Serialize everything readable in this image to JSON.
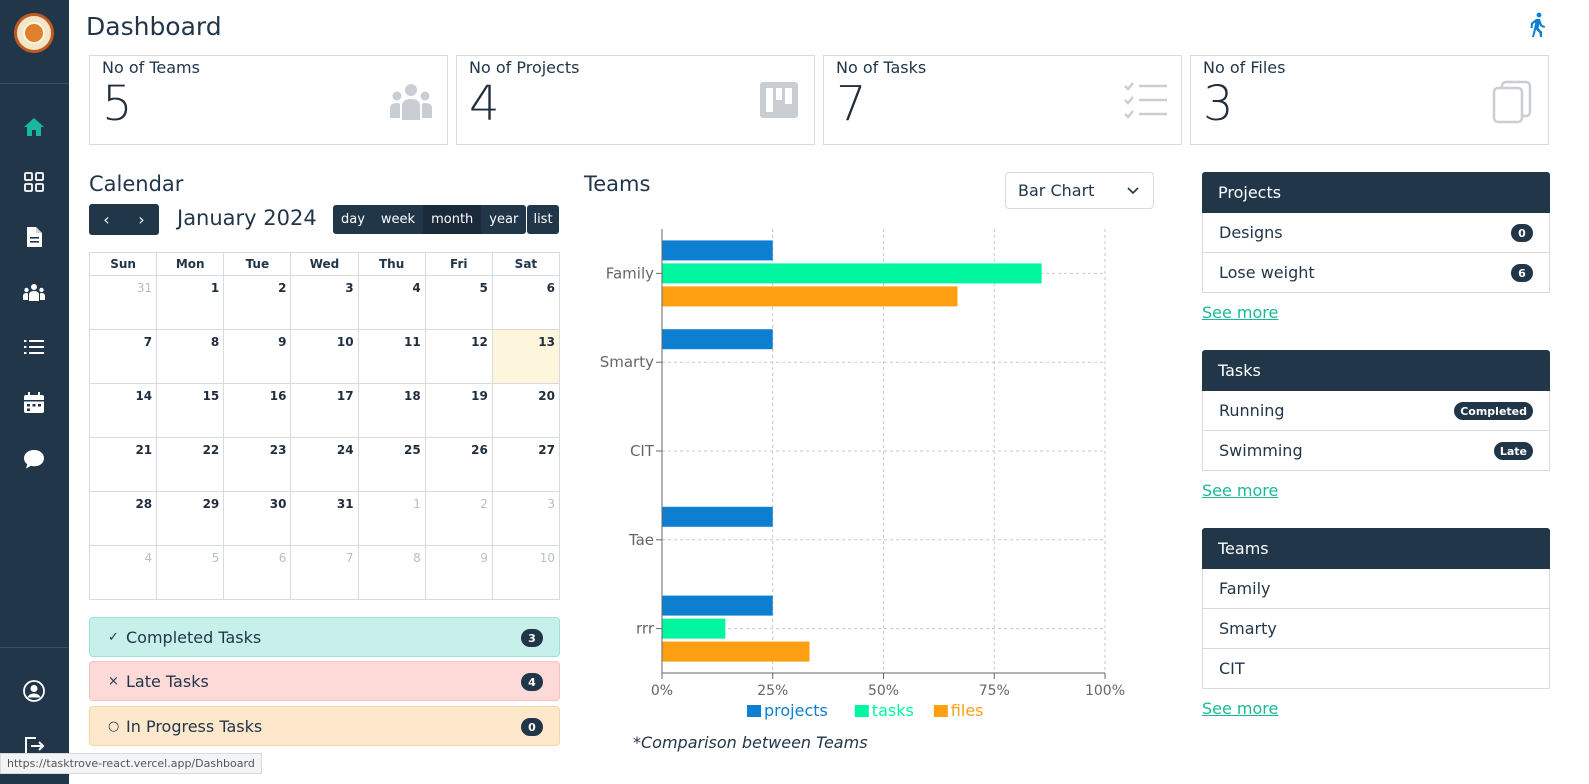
{
  "header": {
    "title": "Dashboard"
  },
  "colors": {
    "sidebar": "#22364a",
    "accent": "#18b99a",
    "projects": "#0d7fd0",
    "tasks": "#00f7a0",
    "files": "#ff9f12"
  },
  "sidebar": {
    "items": [
      {
        "icon": "home-icon"
      },
      {
        "icon": "grid-icon"
      },
      {
        "icon": "file-icon"
      },
      {
        "icon": "users-icon"
      },
      {
        "icon": "list-icon"
      },
      {
        "icon": "calendar-icon"
      },
      {
        "icon": "chat-icon"
      },
      {
        "icon": "account-icon"
      },
      {
        "icon": "logout-icon"
      }
    ]
  },
  "stats": [
    {
      "label": "No of Teams",
      "value": "5",
      "icon": "team-icon"
    },
    {
      "label": "No of Projects",
      "value": "4",
      "icon": "board-icon"
    },
    {
      "label": "No of Tasks",
      "value": "7",
      "icon": "checklist-icon"
    },
    {
      "label": "No of Files",
      "value": "3",
      "icon": "files-icon"
    }
  ],
  "calendar": {
    "title": "Calendar",
    "month": "January 2024",
    "views": [
      "day",
      "week",
      "month",
      "year"
    ],
    "active_view": "month",
    "list_label": "list",
    "weekdays": [
      "Sun",
      "Mon",
      "Tue",
      "Wed",
      "Thu",
      "Fri",
      "Sat"
    ],
    "weeks": [
      [
        "31",
        "1",
        "2",
        "3",
        "4",
        "5",
        "6"
      ],
      [
        "7",
        "8",
        "9",
        "10",
        "11",
        "12",
        "13"
      ],
      [
        "14",
        "15",
        "16",
        "17",
        "18",
        "19",
        "20"
      ],
      [
        "21",
        "22",
        "23",
        "24",
        "25",
        "26",
        "27"
      ],
      [
        "28",
        "29",
        "30",
        "31",
        "1",
        "2",
        "3"
      ],
      [
        "4",
        "5",
        "6",
        "7",
        "8",
        "9",
        "10"
      ]
    ],
    "today": "13"
  },
  "task_status": {
    "completed": {
      "symbol": "✓",
      "label": "Completed Tasks",
      "count": "3"
    },
    "late": {
      "symbol": "×",
      "label": "Late Tasks",
      "count": "4"
    },
    "progress": {
      "symbol": "○",
      "label": "In Progress Tasks",
      "count": "0"
    }
  },
  "teams_chart": {
    "title": "Teams",
    "select_value": "Bar Chart",
    "caption": "*Comparison between Teams"
  },
  "chart_data": {
    "type": "bar",
    "orientation": "horizontal",
    "categories": [
      "Family",
      "Smarty",
      "CIT",
      "Tae",
      "rrr"
    ],
    "series": [
      {
        "name": "projects",
        "values": [
          25,
          25,
          0,
          25,
          25
        ]
      },
      {
        "name": "tasks",
        "values": [
          85.7,
          0,
          0,
          0,
          14.3
        ]
      },
      {
        "name": "files",
        "values": [
          66.7,
          0,
          0,
          0,
          33.3
        ]
      }
    ],
    "xlim": [
      0,
      100
    ],
    "xticks": [
      "0%",
      "25%",
      "50%",
      "75%",
      "100%"
    ],
    "grid": true,
    "legend": "bottom"
  },
  "panels": {
    "projects": {
      "title": "Projects",
      "rows": [
        {
          "label": "Designs",
          "badge": "0"
        },
        {
          "label": "Lose weight",
          "badge": "6"
        }
      ],
      "see_more": "See more"
    },
    "tasks": {
      "title": "Tasks",
      "rows": [
        {
          "label": "Running",
          "badge": "Completed"
        },
        {
          "label": "Swimming",
          "badge": "Late"
        }
      ],
      "see_more": "See more"
    },
    "teams": {
      "title": "Teams",
      "rows": [
        {
          "label": "Family"
        },
        {
          "label": "Smarty"
        },
        {
          "label": "CIT"
        }
      ],
      "see_more": "See more"
    }
  },
  "status_url": "https://tasktrove-react.vercel.app/Dashboard"
}
